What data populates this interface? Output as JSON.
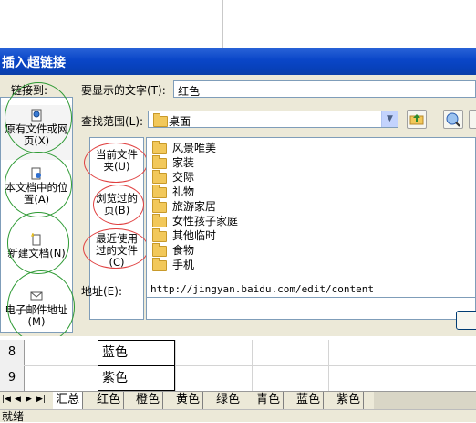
{
  "dialog": {
    "title": "插入超链接",
    "link_to_label": "链接到:",
    "places": [
      {
        "label": "原有文件或网页(X)",
        "line1": "原有文件或网",
        "line2": "页(X)"
      },
      {
        "label": "本文档中的位置(A)",
        "line1": "本文档中的位",
        "line2": "置(A)"
      },
      {
        "label": "新建文档(N)",
        "line1": "新建文档(N)",
        "line2": ""
      },
      {
        "label": "电子邮件地址(M)",
        "line1": "电子邮件地址",
        "line2": "(M)"
      }
    ],
    "display_text_label": "要显示的文字(T):",
    "display_text_value": "红色",
    "look_in_label": "查找范围(L):",
    "look_in_value": "桌面",
    "subnav": [
      {
        "line1": "当前文件",
        "line2": "夹(U)"
      },
      {
        "line1": "浏览过的",
        "line2": "页(B)"
      },
      {
        "line1": "最近使用",
        "line2": "过的文件",
        "line3": "(C)"
      }
    ],
    "files": [
      "风景唯美",
      "家装",
      "交际",
      "礼物",
      "旅游家居",
      "女性孩子家庭",
      "其他临时",
      "食物",
      "手机"
    ],
    "address_label": "地址(E):",
    "address_value": "http://jingyan.baidu.com/edit/content"
  },
  "sheet": {
    "rows": [
      {
        "num": "8",
        "value": "蓝色"
      },
      {
        "num": "9",
        "value": "紫色"
      }
    ],
    "tabs": [
      "汇总",
      "红色",
      "橙色",
      "黄色",
      "绿色",
      "青色",
      "蓝色",
      "紫色"
    ],
    "status": "就绪"
  }
}
